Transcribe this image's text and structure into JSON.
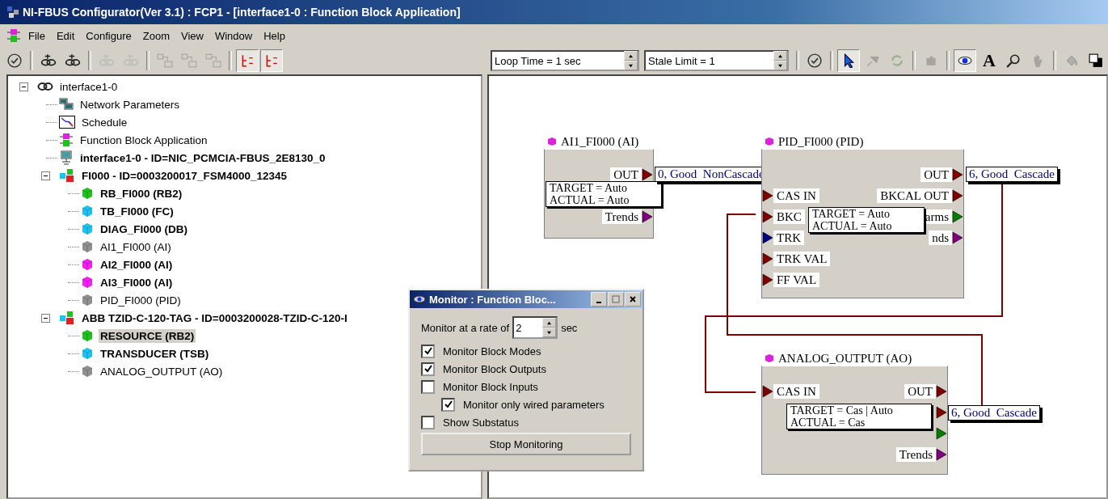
{
  "window": {
    "title": "NI-FBUS Configurator(Ver 3.1) : FCP1 - [interface1-0 : Function Block Application]"
  },
  "menu": [
    "File",
    "Edit",
    "Configure",
    "Zoom",
    "View",
    "Window",
    "Help"
  ],
  "left_toolbar": [
    [
      {
        "kind": "check",
        "disabled": false,
        "pressed": false
      }
    ],
    [
      {
        "kind": "chain",
        "disabled": false,
        "pressed": false
      },
      {
        "kind": "chain",
        "disabled": false,
        "pressed": false
      }
    ],
    [
      {
        "kind": "chain",
        "disabled": true,
        "pressed": false
      },
      {
        "kind": "chain",
        "disabled": true,
        "pressed": false
      }
    ],
    [
      {
        "kind": "boxes",
        "disabled": true,
        "pressed": false
      },
      {
        "kind": "boxes",
        "disabled": true,
        "pressed": false
      },
      {
        "kind": "boxes",
        "disabled": true,
        "pressed": false
      }
    ],
    [
      {
        "kind": "tree",
        "disabled": false,
        "pressed": true
      },
      {
        "kind": "tree",
        "disabled": false,
        "pressed": true
      }
    ]
  ],
  "tree": [
    {
      "label": "interface1-0",
      "kind": "chain",
      "bold": false,
      "selected": false,
      "expanded": true,
      "children": [
        {
          "label": "Network Parameters",
          "kind": "network",
          "bold": false,
          "selected": false
        },
        {
          "label": "Schedule",
          "kind": "schedule",
          "bold": false,
          "selected": false
        },
        {
          "label": "Function Block Application",
          "kind": "fba",
          "bold": false,
          "selected": false
        },
        {
          "label": "interface1-0 - ID=NIC_PCMCIA-FBUS_2E8130_0",
          "kind": "las",
          "bold": true,
          "selected": false
        },
        {
          "label": "FI000 - ID=0003200017_FSM4000_12345",
          "kind": "device",
          "bold": true,
          "selected": false,
          "expanded": true,
          "children": [
            {
              "label": "RB_FI000 (RB2)",
              "kind": "cube",
              "color": "#20c020",
              "bold": true,
              "selected": false
            },
            {
              "label": "TB_FI000 (FC)",
              "kind": "cube",
              "color": "#20c0f0",
              "bold": true,
              "selected": false
            },
            {
              "label": "DIAG_FI000 (DB)",
              "kind": "cube",
              "color": "#20c0f0",
              "bold": true,
              "selected": false
            },
            {
              "label": "AI1_FI000 (AI)",
              "kind": "cube",
              "color": "#909090",
              "bold": false,
              "selected": false
            },
            {
              "label": "AI2_FI000 (AI)",
              "kind": "cube",
              "color": "#f020f0",
              "bold": true,
              "selected": false
            },
            {
              "label": "AI3_FI000 (AI)",
              "kind": "cube",
              "color": "#f020f0",
              "bold": true,
              "selected": false
            },
            {
              "label": "PID_FI000 (PID)",
              "kind": "cube",
              "color": "#909090",
              "bold": false,
              "selected": false
            }
          ]
        },
        {
          "label": "ABB TZID-C-120-TAG - ID=0003200028-TZID-C-120-I",
          "kind": "device",
          "bold": true,
          "selected": false,
          "expanded": true,
          "children": [
            {
              "label": "RESOURCE (RB2)",
              "kind": "cube",
              "color": "#20c020",
              "bold": true,
              "selected": true
            },
            {
              "label": "TRANSDUCER (TSB)",
              "kind": "cube",
              "color": "#20c0f0",
              "bold": true,
              "selected": false
            },
            {
              "label": "ANALOG_OUTPUT (AO)",
              "kind": "cube",
              "color": "#909090",
              "bold": false,
              "selected": false
            }
          ]
        }
      ]
    }
  ],
  "right_toolbar": {
    "loop_time": "Loop Time = 1 sec",
    "stale_limit": "Stale Limit = 1",
    "groups": [
      [
        {
          "kind": "check",
          "disabled": false,
          "pressed": false
        }
      ],
      [
        {
          "kind": "pointer",
          "disabled": false,
          "pressed": true
        },
        {
          "kind": "pin",
          "disabled": true,
          "pressed": false
        },
        {
          "kind": "refresh",
          "disabled": true,
          "pressed": false
        }
      ],
      [
        {
          "kind": "puzzle",
          "disabled": true,
          "pressed": false
        }
      ],
      [
        {
          "kind": "eye",
          "disabled": false,
          "pressed": true
        },
        {
          "kind": "text",
          "glyph": "A",
          "disabled": false,
          "pressed": false
        },
        {
          "kind": "magnifier",
          "disabled": false,
          "pressed": false
        },
        {
          "kind": "hand",
          "disabled": true,
          "pressed": false
        }
      ],
      [
        {
          "kind": "paint",
          "disabled": true,
          "pressed": false
        },
        {
          "kind": "colors",
          "disabled": false,
          "pressed": false
        }
      ]
    ]
  },
  "blocks": [
    {
      "title": "AI1_FI000 (AI)",
      "color": "#e020e0",
      "value": "0, Good  NonCascade",
      "modes": [
        "TARGET = Auto",
        "ACTUAL = Auto"
      ],
      "rows": [
        {
          "kind": "ports",
          "right": {
            "label": "OUT",
            "color": "#800000"
          }
        },
        {
          "kind": "covered"
        },
        {
          "kind": "ports",
          "right": {
            "label": "Trends",
            "color": "#800080"
          }
        }
      ]
    },
    {
      "title": "PID_FI000 (PID)",
      "color": "#e020e0",
      "value": "6, Good  Cascade",
      "modes": [
        "TARGET = Auto",
        "ACTUAL = Auto"
      ],
      "rows": [
        {
          "kind": "ports",
          "right": {
            "label": "OUT",
            "color": "#800000"
          }
        },
        {
          "kind": "ports",
          "left": {
            "label": "CAS  IN",
            "color": "#800000"
          },
          "right": {
            "label": "BKCAL  OUT",
            "color": "#800000"
          }
        },
        {
          "kind": "ports",
          "left": {
            "label": "BKC",
            "color": "#800000"
          },
          "right": {
            "label": "arms",
            "color": "#008000"
          }
        },
        {
          "kind": "ports",
          "left": {
            "label": "TRK",
            "color": "#000080"
          },
          "right": {
            "label": "nds",
            "color": "#800080"
          }
        },
        {
          "kind": "ports",
          "left": {
            "label": "TRK  VAL",
            "color": "#800000"
          }
        },
        {
          "kind": "ports",
          "left": {
            "label": "FF  VAL",
            "color": "#800000"
          }
        }
      ]
    },
    {
      "title": "ANALOG_OUTPUT (AO)",
      "color": "#e020e0",
      "value": "6, Good  Cascade",
      "modes": [
        "TARGET = Cas | Auto",
        "ACTUAL = Cas"
      ],
      "rows": [
        {
          "kind": "ports",
          "left": {
            "label": "CAS  IN",
            "color": "#800000"
          },
          "right": {
            "label": "OUT",
            "color": "#800000"
          }
        },
        {
          "kind": "ports",
          "right": {
            "color": "#800000"
          }
        },
        {
          "kind": "ports",
          "right": {
            "color": "#008000"
          }
        },
        {
          "kind": "ports",
          "right": {
            "label": "Trends",
            "color": "#800080"
          }
        }
      ]
    }
  ],
  "monitor_dialog": {
    "title": "Monitor : Function Bloc...",
    "rate_label": "Monitor at a rate of",
    "rate": "2",
    "rate_unit": "sec",
    "options": [
      {
        "label": "Monitor Block Modes",
        "checked": true
      },
      {
        "label": "Monitor Block Outputs",
        "checked": true
      },
      {
        "label": "Monitor Block Inputs",
        "checked": false,
        "children": [
          {
            "label": "Monitor only wired parameters",
            "checked": true
          }
        ]
      },
      {
        "label": "Show Substatus",
        "checked": false
      }
    ],
    "button": "Stop Monitoring"
  }
}
